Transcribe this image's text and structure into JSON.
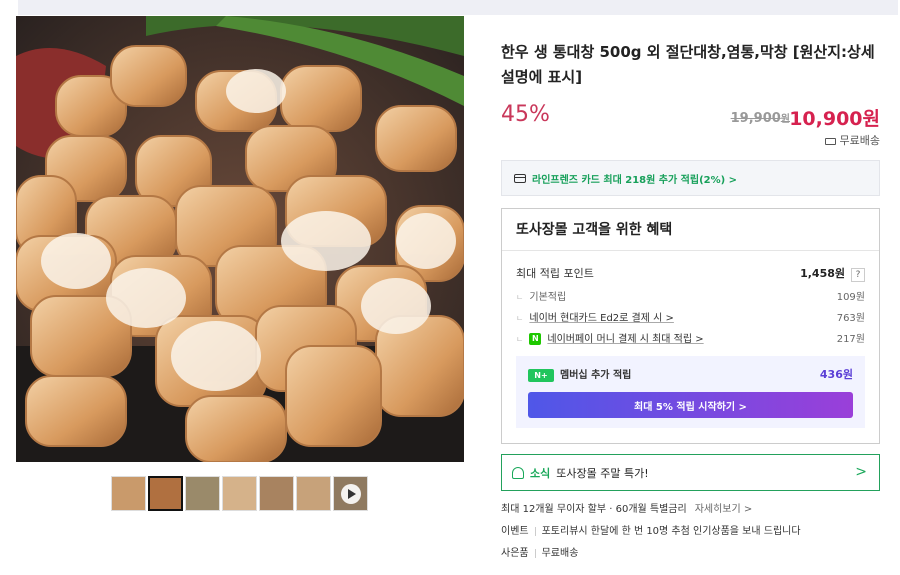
{
  "product": {
    "title": "한우 생 통대창 500g 외 절단대창,염통,막창 [원산지:상세설명에 표시]",
    "discount": "45%",
    "original_price": "19,900",
    "original_price_unit": "원",
    "sale_price": "10,900원",
    "shipping": "무료배송"
  },
  "card_promo": {
    "text": "라인프렌즈 카드 최대 218원 추가 적립(2%) >"
  },
  "benefits": {
    "heading": "또사장몰 고객을 위한 혜택",
    "max_points_label": "최대 적립 포인트",
    "max_points_value": "1,458원",
    "help": "?",
    "rows": [
      {
        "label": "기본적립",
        "value": "109원"
      },
      {
        "label": "네이버 현대카드 Ed2로 결제 시 >",
        "value": "763원"
      },
      {
        "label": "네이버페이 머니 결제 시 최대 적립 >",
        "value": "217원"
      }
    ],
    "npay_badge": "N",
    "membership": {
      "badge": "N+",
      "label": "멤버십 추가 적립",
      "value": "436원",
      "button": "최대 5% 적립 시작하기 >"
    }
  },
  "news": {
    "tag": "소식",
    "text": "또사장몰 주말 특가!",
    "chevron": ">"
  },
  "info": {
    "installment": "최대 12개월 무이자 할부 · 60개월 특별금리",
    "more": "자세히보기 >",
    "event_key": "이벤트",
    "event_value": "포토리뷰시 한달에 한 번 10명 추첨 인기상품을 보내 드립니다",
    "gift_key": "사은품",
    "gift_value": "무료배송"
  },
  "colors": {
    "discount": "#c9375a",
    "sale_price": "#d6224f",
    "green": "#1aa85a",
    "membership_purple": "#5b3fd6"
  }
}
